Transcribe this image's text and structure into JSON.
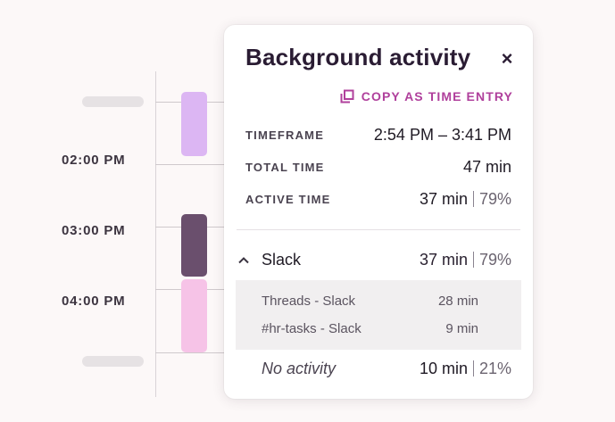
{
  "timeline": {
    "times": [
      "02:00 PM",
      "03:00 PM",
      "04:00 PM"
    ],
    "colors": {
      "block_lavender": "#dcb6f3",
      "block_active": "#6a4f6d",
      "block_pink": "#f6c3e7"
    }
  },
  "panel": {
    "title": "Background activity",
    "close_icon": "×",
    "copy_label": "COPY AS TIME ENTRY",
    "rows": {
      "timeframe": {
        "label": "TIMEFRAME",
        "value": "2:54 PM – 3:41 PM"
      },
      "total": {
        "label": "TOTAL TIME",
        "value": "47 min"
      },
      "active": {
        "label": "ACTIVE TIME",
        "value": "37 min",
        "pct": "79%"
      }
    },
    "app": {
      "name": "Slack",
      "value": "37 min",
      "pct": "79%",
      "items": [
        {
          "name": "Threads - Slack",
          "time": "28 min"
        },
        {
          "name": "#hr-tasks - Slack",
          "time": "9 min"
        }
      ]
    },
    "no_activity": {
      "label": "No activity",
      "value": "10 min",
      "pct": "21%"
    },
    "accent_color": "#b0409c"
  }
}
